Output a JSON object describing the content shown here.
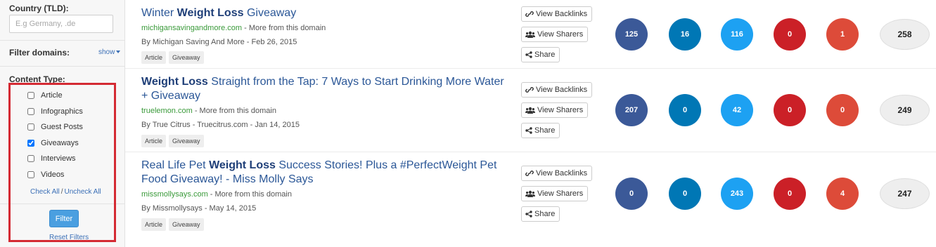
{
  "sidebar": {
    "country_label": "Country (TLD):",
    "country_placeholder": "E.g Germany, .de",
    "filter_domains_label": "Filter domains:",
    "show_label": "show",
    "content_type_label": "Content Type:",
    "content_types": [
      {
        "label": "Article",
        "checked": false
      },
      {
        "label": "Infographics",
        "checked": false
      },
      {
        "label": "Guest Posts",
        "checked": false
      },
      {
        "label": "Giveaways",
        "checked": true
      },
      {
        "label": "Interviews",
        "checked": false
      },
      {
        "label": "Videos",
        "checked": false
      }
    ],
    "check_all_label": "Check All",
    "separator": "/",
    "uncheck_all_label": "Uncheck All",
    "filter_button_label": "Filter",
    "reset_filters_label": "Reset Filters",
    "highlight_color": "#d42a33"
  },
  "actions": {
    "view_backlinks": "View Backlinks",
    "view_sharers": "View Sharers",
    "share": "Share"
  },
  "metric_colors": [
    "#3b5998",
    "#0077b5",
    "#1da1f2",
    "#cb2027",
    "#dd4b39"
  ],
  "results": [
    {
      "title_parts": [
        {
          "text": "Winter ",
          "bold": false
        },
        {
          "text": "Weight Loss",
          "bold": true
        },
        {
          "text": " Giveaway",
          "bold": false
        }
      ],
      "domain": "michigansavingandmore.com",
      "more_text": " - More from this domain",
      "byline": "By Michigan Saving And More - Feb 26, 2015",
      "tags": [
        "Article",
        "Giveaway"
      ],
      "metrics": [
        "125",
        "16",
        "116",
        "0",
        "1"
      ],
      "total": "258"
    },
    {
      "title_parts": [
        {
          "text": "Weight Loss",
          "bold": true
        },
        {
          "text": " Straight from the Tap: 7 Ways to Start Drinking More Water + Giveaway",
          "bold": false
        }
      ],
      "domain": "truelemon.com",
      "more_text": " - More from this domain",
      "byline": "By True Citrus - Truecitrus.com - Jan 14, 2015",
      "tags": [
        "Article",
        "Giveaway"
      ],
      "metrics": [
        "207",
        "0",
        "42",
        "0",
        "0"
      ],
      "total": "249"
    },
    {
      "title_parts": [
        {
          "text": "Real Life Pet ",
          "bold": false
        },
        {
          "text": "Weight Loss",
          "bold": true
        },
        {
          "text": " Success Stories! Plus a #PerfectWeight Pet Food Giveaway! - Miss Molly Says",
          "bold": false
        }
      ],
      "domain": "missmollysays.com",
      "more_text": " - More from this domain",
      "byline": "By Missmollysays - May 14, 2015",
      "tags": [
        "Article",
        "Giveaway"
      ],
      "metrics": [
        "0",
        "0",
        "243",
        "0",
        "4"
      ],
      "total": "247"
    }
  ]
}
